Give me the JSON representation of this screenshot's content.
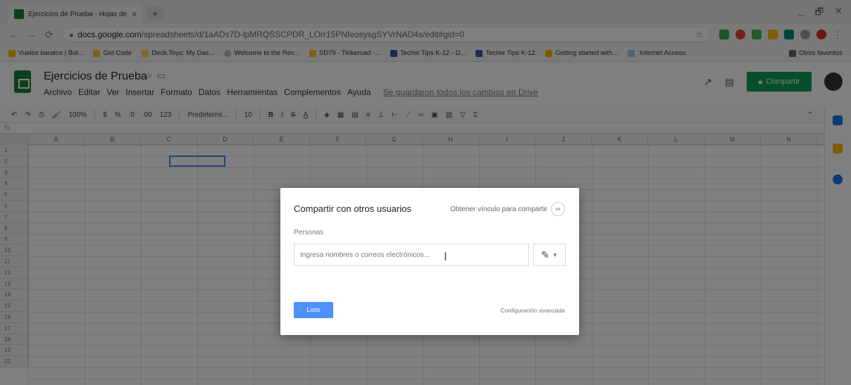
{
  "browser": {
    "tab_title": "Ejercicios de Prueba - Hojas de c",
    "tab_close": "×",
    "new_tab": "+",
    "window_controls": [
      "_",
      "🗗",
      "✕"
    ],
    "url_host": "docs.google.com",
    "url_path": "/spreadsheets/d/1aADs7D-lpMRQSSCPDR_LOrr15PNfeosysgSYVrNAD4s/edit#gid=0",
    "bookmarks": [
      "Vuelos baratos | Bol...",
      "Get Code",
      "Deck.Toys: My Das...",
      "Welcome to the Rev...",
      "SD79 - Tinkercad -...",
      "Techie Tips K-12 - D...",
      "Techie Tips K-12",
      "Getting started with...",
      ":Internet Access:"
    ],
    "bookmarks_other": "Otros favoritos"
  },
  "sheets": {
    "doc_title": "Ejercicios de Prueba",
    "menu": [
      "Archivo",
      "Editar",
      "Ver",
      "Insertar",
      "Formato",
      "Datos",
      "Herramientas",
      "Complementos",
      "Ayuda"
    ],
    "save_status": "Se guardaron todos los cambios en Drive",
    "share_label": "Compartir",
    "toolbar": {
      "zoom": "100%",
      "currency": "$",
      "percent": "%",
      "decimal_less": ".0",
      "decimal_more": ".00",
      "number_format": "123",
      "font": "Predetermi...",
      "font_size": "10",
      "bold": "B",
      "italic": "I",
      "strike": "S",
      "text_color": "A"
    },
    "formula_label": "fx",
    "columns": [
      "A",
      "B",
      "C",
      "D",
      "E",
      "F",
      "G",
      "H",
      "I",
      "J",
      "K",
      "L",
      "M",
      "N"
    ],
    "rows": [
      "1",
      "2",
      "3",
      "4",
      "5",
      "6",
      "7",
      "8",
      "9",
      "10",
      "11",
      "12",
      "13",
      "14",
      "15",
      "16",
      "17",
      "18",
      "19",
      "20"
    ]
  },
  "dialog": {
    "title": "Compartir con otros usuarios",
    "link_label": "Obtener vínculo para compartir",
    "section_label": "Personas",
    "input_placeholder": "Ingresa nombres o correos electrónicos...",
    "done_label": "Listo",
    "advanced_label": "Configuración avanzada"
  }
}
